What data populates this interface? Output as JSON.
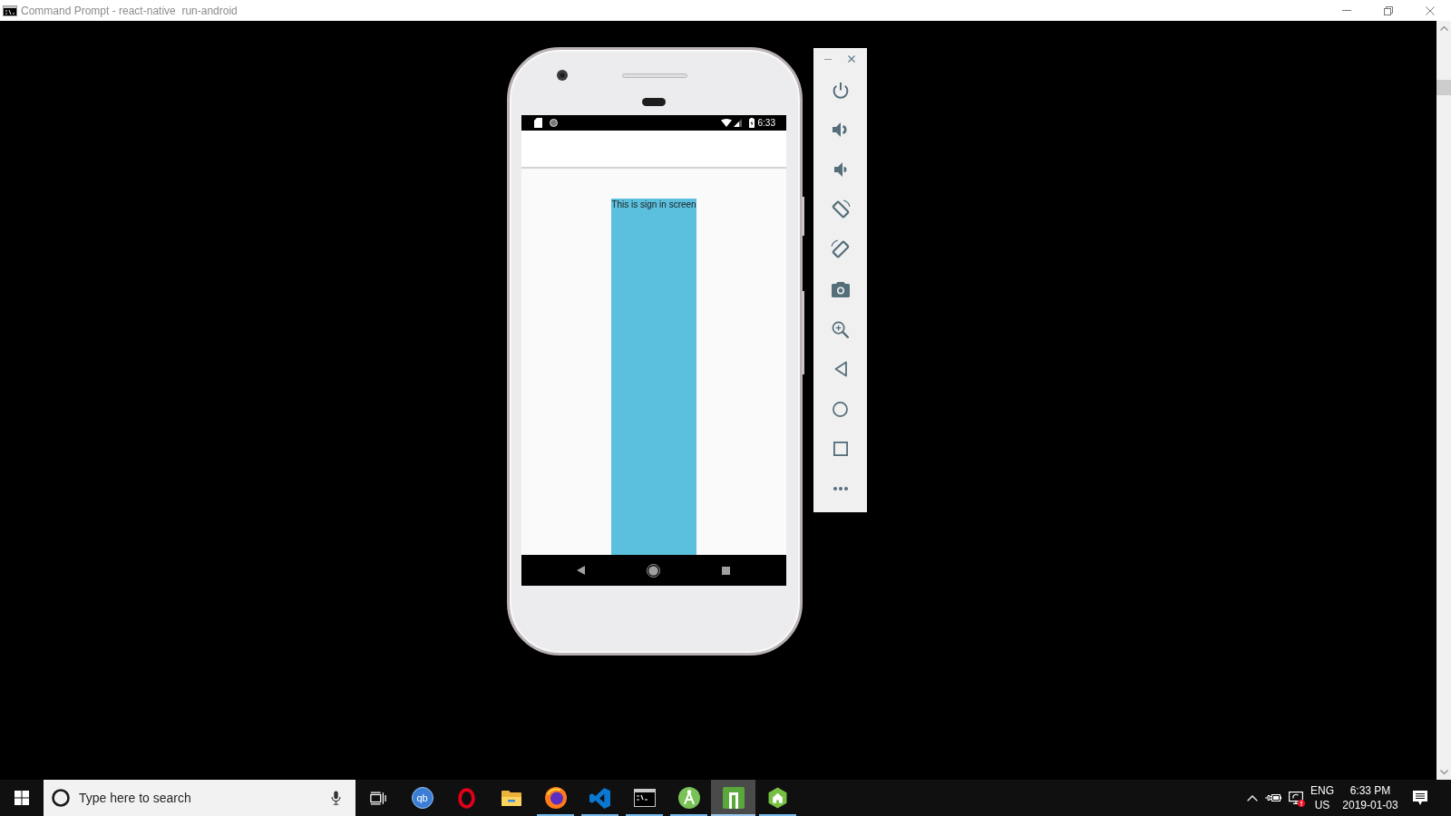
{
  "window": {
    "title": "Command Prompt - react-native  run-android"
  },
  "phone": {
    "status_bar": {
      "time": "6:33"
    },
    "screen": {
      "text": "This is sign in screen"
    }
  },
  "taskbar": {
    "search": {
      "placeholder": "Type here to search"
    },
    "apps": [
      {
        "kind": "ball",
        "label": "qb",
        "running": false,
        "selected": false
      },
      {
        "kind": "ring",
        "running": false,
        "selected": false
      },
      {
        "kind": "folder",
        "running": false,
        "selected": false
      },
      {
        "kind": "globe",
        "running": true,
        "selected": false
      },
      {
        "kind": "ribbon",
        "running": true,
        "selected": false
      },
      {
        "kind": "console",
        "running": true,
        "selected": false
      },
      {
        "kind": "compass",
        "running": true,
        "selected": false
      },
      {
        "kind": "tile",
        "running": true,
        "selected": true
      },
      {
        "kind": "hexagon",
        "running": true,
        "selected": false
      }
    ],
    "tray": {
      "alert": true,
      "language": "ENG",
      "region": "US",
      "time": "6:33 PM",
      "date": "2019-01-03"
    }
  }
}
